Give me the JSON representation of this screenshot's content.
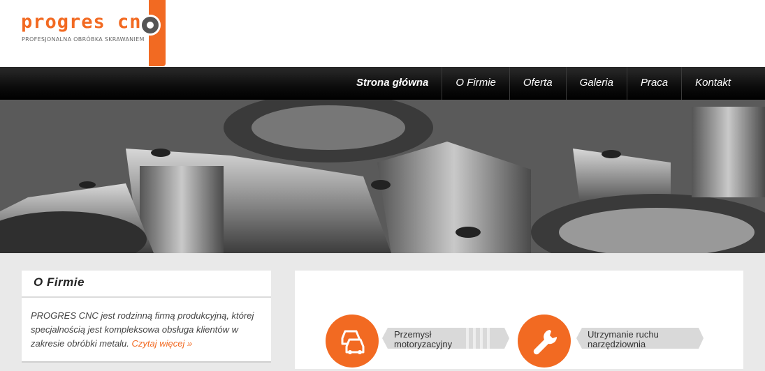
{
  "logo": {
    "name": "progres cnc",
    "tagline": "PROFESJONALNA OBRÓBKA SKRAWANIEM"
  },
  "nav": {
    "items": [
      "Strona główna",
      "O Firmie",
      "Oferta",
      "Galeria",
      "Praca",
      "Kontakt"
    ]
  },
  "about": {
    "title": "O Firmie",
    "text": "PROGRES CNC jest rodzinną firmą produkcyjną, której specjalnością jest kompleksowa obsługa klientów w zakresie obróbki metalu.",
    "link": "Czytaj więcej »"
  },
  "services": [
    {
      "label1": "Przemysł",
      "label2": "motoryzacyjny",
      "icon": "cars-icon"
    },
    {
      "label1": "Utrzymanie ruchu",
      "label2": "narzędziownia",
      "icon": "wrench-icon"
    }
  ],
  "colors": {
    "accent": "#f26a22",
    "nav_bg": "#0c0c0c"
  }
}
